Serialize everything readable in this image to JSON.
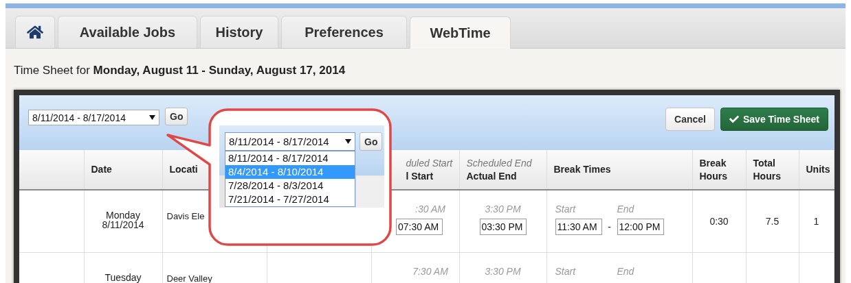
{
  "tabs": [
    {
      "kind": "home",
      "selected": false
    },
    {
      "kind": "text",
      "label": "Available Jobs",
      "selected": false
    },
    {
      "kind": "text",
      "label": "History",
      "selected": false
    },
    {
      "kind": "text",
      "label": "Preferences",
      "selected": false
    },
    {
      "kind": "text",
      "label": "WebTime",
      "selected": true
    }
  ],
  "heading": "Time Sheet for **Monday, August 11 - Sunday, August 17, 2014**",
  "toolbar": {
    "week_select": "8/11/2014 - 8/17/2014",
    "go": "Go",
    "buttons": [
      {
        "kind": "cancel",
        "label": "Cancel"
      },
      {
        "kind": "save",
        "label": "Save Time Sheet"
      }
    ]
  },
  "table": {
    "columns": [
      {
        "kind": "blank"
      },
      {
        "kind": "text",
        "title": "Date"
      },
      {
        "kind": "text",
        "title": "Locati"
      },
      {
        "kind": "blank"
      },
      {
        "kind": "split",
        "scheduled": "duled Start",
        "title": "l Start"
      },
      {
        "kind": "split",
        "scheduled": "Scheduled End",
        "title": "Actual End"
      },
      {
        "kind": "text",
        "title": "Break Times"
      },
      {
        "kind": "text",
        "title": "Break Hours"
      },
      {
        "kind": "text",
        "title": "Total Hours"
      },
      {
        "kind": "text",
        "title": "Units"
      }
    ],
    "rows": [
      {
        "day": "Monday",
        "date": "8/11/2014",
        "location": "Davis Ele",
        "scheduled_start": ":30 AM",
        "actual_start": "07:30 AM",
        "scheduled_end": "3:30 PM",
        "actual_end": "03:30 PM",
        "break_start_label": "Start",
        "break_end_label": "End",
        "break_start": "11:30 AM",
        "break_separator": "-",
        "break_end": "12:00 PM",
        "break_hours": "0:30",
        "total_hours": "7.5",
        "units": "1"
      },
      {
        "day": "Tuesday",
        "location": "Deer Valley",
        "scheduled_start": "7:30 AM",
        "scheduled_end": "3:30 PM",
        "break_start_label": "Start",
        "break_end_label": "End"
      }
    ]
  },
  "callout": {
    "select": "8/11/2014 - 8/17/2014",
    "go": "Go",
    "options": [
      {
        "label": "8/11/2014 - 8/17/2014",
        "selected": false
      },
      {
        "label": "8/4/2014 - 8/10/2014",
        "selected": true
      },
      {
        "label": "7/28/2014 - 8/3/2014",
        "selected": false
      },
      {
        "label": "7/21/2014 - 7/27/2014",
        "selected": false
      }
    ]
  }
}
